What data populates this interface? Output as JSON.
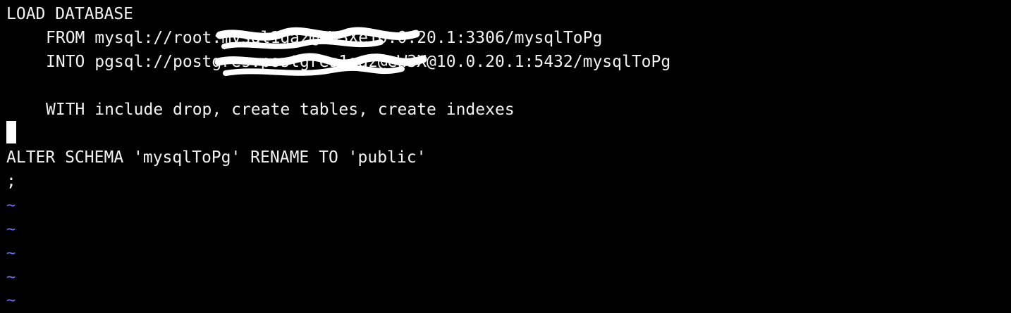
{
  "editor": {
    "lines": {
      "load": "LOAD DATABASE",
      "from": "FROM mysql://root:mysql1qaz@eW3Xe10.0.20.1:3306/mysqlToPg",
      "into": "INTO pgsql://postgres:postgres1qaz@eW3X@10.0.20.1:5432/mysqlToPg",
      "with": "WITH include drop, create tables, create indexes",
      "alter": "ALTER SCHEMA 'mysqlToPg' RENAME TO 'public'",
      "semicolon": ";"
    },
    "empty_line_marker": "~",
    "colors": {
      "background": "#000000",
      "text": "#f2f2f2",
      "tilde": "#6f6ff5",
      "cursor": "#ffffff"
    }
  }
}
